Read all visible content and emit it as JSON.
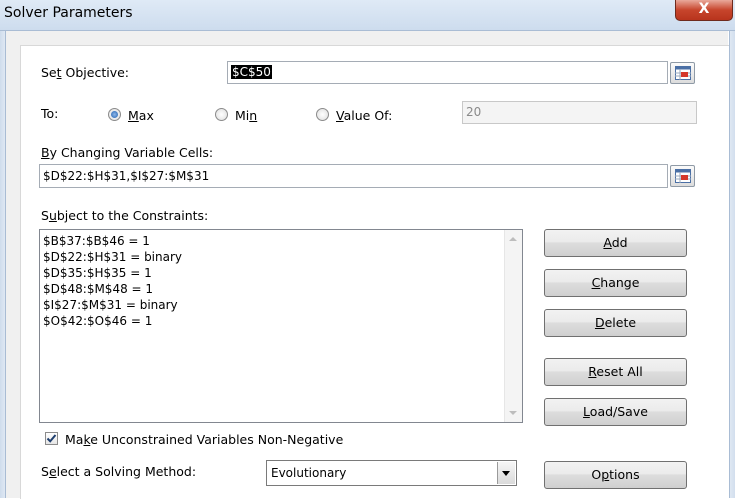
{
  "window": {
    "title": "Solver Parameters",
    "close_glyph": "X"
  },
  "objective": {
    "label_pre": "Se",
    "label_key": "t",
    "label_post": " Objective:",
    "value": "$C$50"
  },
  "to": {
    "label": "To:",
    "max": {
      "label_key": "M",
      "label_post": "ax",
      "checked": true
    },
    "min": {
      "label_pre": "Mi",
      "label_key": "n",
      "checked": false
    },
    "value_of": {
      "label_key": "V",
      "label_post": "alue Of:",
      "checked": false,
      "value": "20"
    }
  },
  "changing": {
    "label_key": "B",
    "label_post": "y Changing Variable Cells:",
    "value": "$D$22:$H$31,$I$27:$M$31"
  },
  "constraints": {
    "label_key": "u",
    "label_pre": "S",
    "label_post": "bject to the Constraints:",
    "items": [
      "$B$37:$B$46 = 1",
      "$D$22:$H$31 = binary",
      "$D$35:$H$35 = 1",
      "$D$48:$M$48 = 1",
      "$I$27:$M$31 = binary",
      "$O$42:$O$46 = 1"
    ]
  },
  "buttons": {
    "add": {
      "key": "A",
      "rest": "dd"
    },
    "change": {
      "key": "C",
      "rest": "hange"
    },
    "delete": {
      "key": "D",
      "rest": "elete"
    },
    "reset": {
      "key": "R",
      "rest": "eset All"
    },
    "load": {
      "key": "L",
      "rest": "oad/Save"
    },
    "options": {
      "pre": "O",
      "key": "p",
      "rest": "tions"
    }
  },
  "nonneg": {
    "label_pre": "Ma",
    "label_key": "k",
    "label_post": "e Unconstrained Variables Non-Negative",
    "checked": true
  },
  "method": {
    "label_pre": "S",
    "label_key": "e",
    "label_post": "lect a Solving Method:",
    "value": "Evolutionary"
  },
  "icons": {
    "ref": "range-selector-icon",
    "check": "checkmark-icon"
  },
  "colors": {
    "close": "#c7452c",
    "radio_selected": "#1d5fb0"
  }
}
